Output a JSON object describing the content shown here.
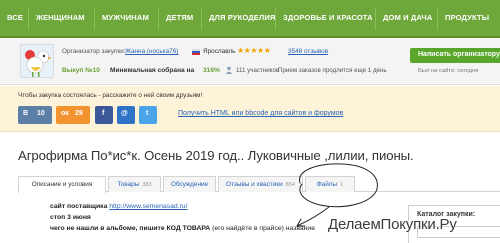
{
  "nav": {
    "items": [
      "ВСЕ",
      "ЖЕНЩИНАМ",
      "МУЖЧИНАМ",
      "ДЕТЯМ",
      "ДЛЯ РУКОДЕЛИЯ",
      "ЗДОРОВЬЕ И КРАСОТА",
      "ДОМ И ДАЧА",
      "ПРОДУКТЫ"
    ]
  },
  "organizer": {
    "label": "Организатор закупки:",
    "name": "Жанна (носька76)",
    "city": "Ярославль",
    "rating_stars": "★★★★★",
    "reviews": "3548 отзывов",
    "issue": "Выкуп №10",
    "min_label": "Минимальная собрана на",
    "min_value": "316%",
    "participants": "111 участников",
    "accept": "Прием заказов продлится еще 1 день",
    "write_button": "Написать организатору",
    "last_visit": "Был на сайте: сегодня"
  },
  "share": {
    "text": "Чтобы закупка состоялась - расскажите о ней своим друзьям!",
    "buttons": [
      {
        "icon": "vk-icon",
        "glyph": "В",
        "count": "10",
        "color": "#5b7fa6"
      },
      {
        "icon": "odnoklassniki-icon",
        "glyph": "ок",
        "count": "29",
        "color": "#f29330"
      },
      {
        "icon": "facebook-icon",
        "glyph": "f",
        "count": "",
        "color": "#3b5998"
      },
      {
        "icon": "mail-icon",
        "glyph": "@",
        "count": "",
        "color": "#2f73c9"
      },
      {
        "icon": "twitter-icon",
        "glyph": "t",
        "count": "",
        "color": "#4ba3e8"
      }
    ],
    "html_link": "Получить HTML или bbcode для сайтов и форумов"
  },
  "title": "Агрофирма По*ис*к. Осень 2019 год.. Луковичные ,лилии, пионы.",
  "tabs": [
    {
      "label": "Описание и условия",
      "count": ""
    },
    {
      "label": "Товары",
      "count": "383"
    },
    {
      "label": "Обсуждение",
      "count": ""
    },
    {
      "label": "Отзывы и хвастики",
      "count": "854"
    },
    {
      "label": "Файлы",
      "count": "1"
    }
  ],
  "content": {
    "site_label": "сайт поставщика",
    "site_url": "http://www.semenasad.ru/",
    "stop": "стоп 3 июня",
    "not_found_pre": "чего не нашли в альбоме, пишите ",
    "not_found_code": "КОД ТОВАРА",
    "not_found_post": " (его найдёте в прайсе) название"
  },
  "catalog": {
    "title": "Каталог закупки:"
  },
  "watermark": "ДелаемПокупки.Ру",
  "colors": {
    "nav": "#6ea83a",
    "accent_green": "#5aa62c",
    "link": "#2a64b8",
    "share_bg": "#fdf3d9"
  }
}
